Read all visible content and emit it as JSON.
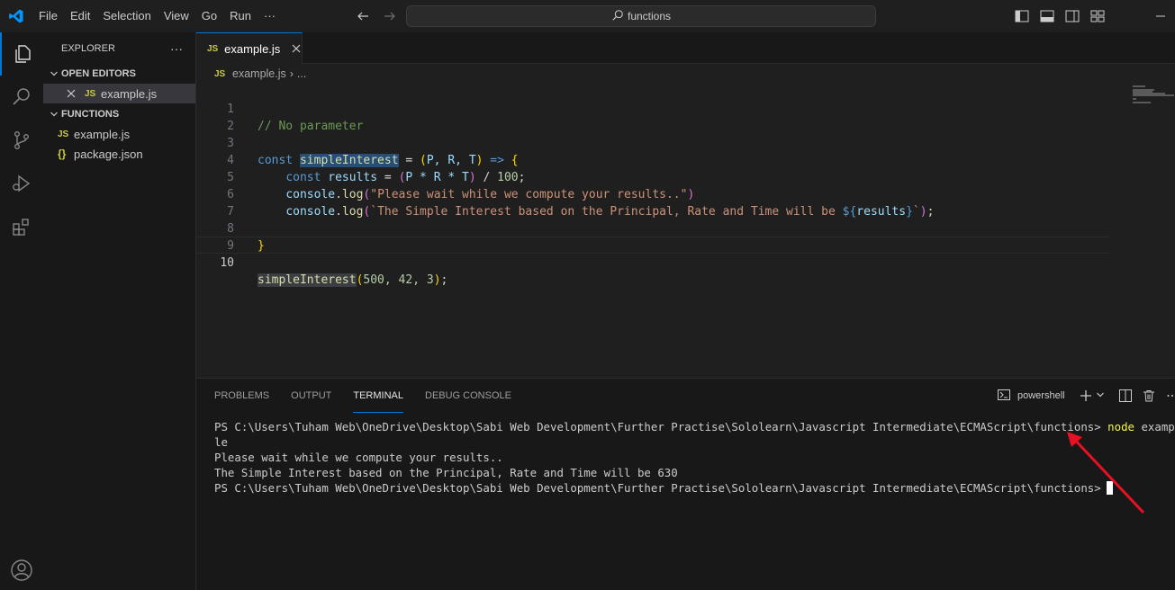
{
  "menu": [
    "File",
    "Edit",
    "Selection",
    "View",
    "Go",
    "Run",
    "···"
  ],
  "command_center": {
    "text": "functions",
    "icon": "search-icon"
  },
  "explorer": {
    "title": "EXPLORER",
    "more": "···",
    "open_editors": {
      "title": "OPEN EDITORS",
      "items": [
        {
          "badge": "JS",
          "name": "example.js"
        }
      ]
    },
    "folder": {
      "title": "FUNCTIONS",
      "items": [
        {
          "badge": "JS",
          "name": "example.js"
        },
        {
          "badge": "{}",
          "name": "package.json"
        }
      ]
    }
  },
  "editor": {
    "tab": {
      "badge": "JS",
      "name": "example.js"
    },
    "breadcrumb": {
      "badge": "JS",
      "file": "example.js",
      "sep": "›",
      "rest": "..."
    },
    "line_numbers": [
      "1",
      "2",
      "3",
      "4",
      "5",
      "6",
      "7",
      "8",
      "9",
      "10"
    ],
    "code": {
      "l1_comment": "// No parameter",
      "l3_const": "const",
      "l3_name": "simpleInterest",
      "l3_eq": " = ",
      "l3_open": "(",
      "l3_params": "P, R, T",
      "l3_close": ")",
      "l3_arrow": " => ",
      "l3_brace": "{",
      "l4_const": "const",
      "l4_var": "results",
      "l4_eq": " = ",
      "l4_open": "(",
      "l4_expr": "P * R * T",
      "l4_close": ")",
      "l4_div": " / ",
      "l4_num": "100",
      "l4_semi": ";",
      "l5_obj": "console",
      "l5_fn": "log",
      "l5_open": "(",
      "l5_str": "\"Please wait while we compute your results..\"",
      "l5_close": ")",
      "l6_obj": "console",
      "l6_fn": "log",
      "l6_open": "(",
      "l6_str": "`The Simple Interest based on the Principal, Rate and Time will be ",
      "l6_interp_open": "${",
      "l6_interp_var": "results",
      "l6_interp_close": "}",
      "l6_tick": "`",
      "l6_close": ")",
      "l6_semi": ";",
      "l8_brace": "}",
      "l10_name": "simpleInterest",
      "l10_open": "(",
      "l10_args": "500, 42, 3",
      "l10_close": ")",
      "l10_semi": ";"
    }
  },
  "panel": {
    "tabs": [
      "PROBLEMS",
      "OUTPUT",
      "TERMINAL",
      "DEBUG CONSOLE"
    ],
    "active_tab": "TERMINAL",
    "shell": "powershell",
    "terminal": {
      "prompt1": "PS C:\\Users\\Tuham Web\\OneDrive\\Desktop\\Sabi Web Development\\Further Practise\\Sololearn\\Javascript Intermediate\\ECMAScript\\functions> ",
      "cmd_node": "node",
      "cmd_arg1": " examp",
      "cmd_arg2": "le",
      "out1": "Please wait while we compute your results..",
      "out2": "The Simple Interest based on the Principal, Rate and Time will be 630",
      "prompt2": "PS C:\\Users\\Tuham Web\\OneDrive\\Desktop\\Sabi Web Development\\Further Practise\\Sololearn\\Javascript Intermediate\\ECMAScript\\functions>"
    }
  },
  "colors": {
    "accent": "#0078d4",
    "annotation_arrow": "#e81123"
  }
}
